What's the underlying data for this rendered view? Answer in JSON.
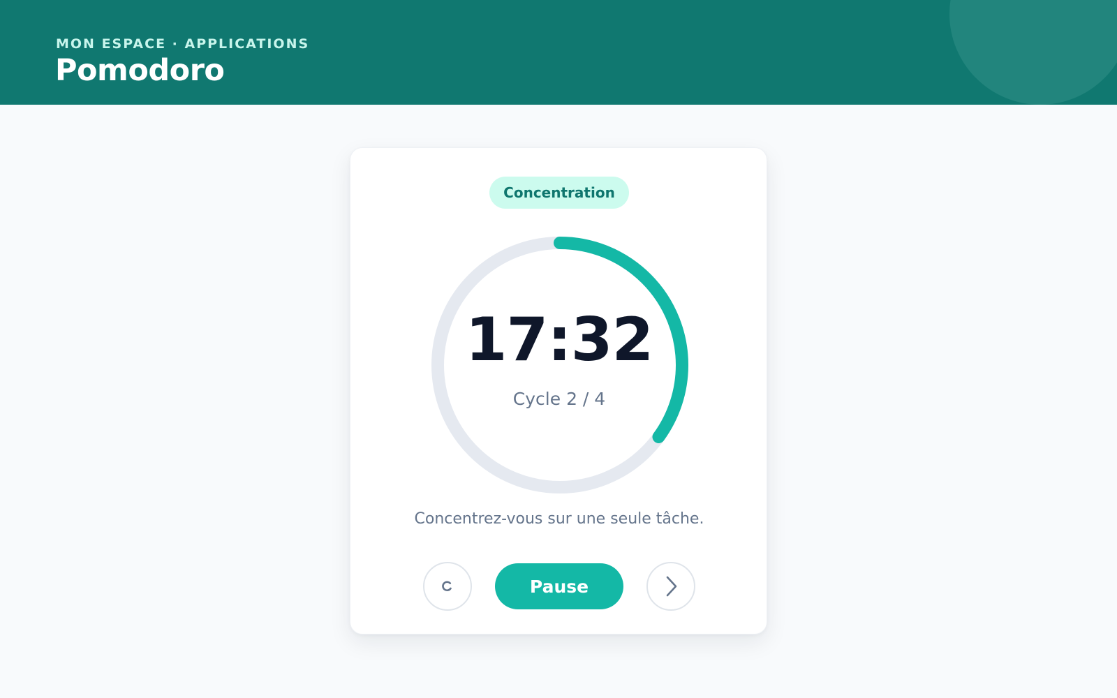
{
  "header": {
    "breadcrumb": "MON ESPACE · APPLICATIONS",
    "title": "Pomodoro",
    "background_color": "#107870"
  },
  "timer": {
    "mode_label": "Concentration",
    "time_remaining": "17:32",
    "cycle_label": "Cycle 2 / 4",
    "progress_fraction": 0.35,
    "hint": "Concentrez-vous sur une seule tâche.",
    "accent_color": "#14b8a6",
    "track_color": "#e5e9f0"
  },
  "controls": {
    "reset_icon": "reset-icon",
    "pause_label": "Pause",
    "skip_icon": "chevron-right-icon"
  }
}
